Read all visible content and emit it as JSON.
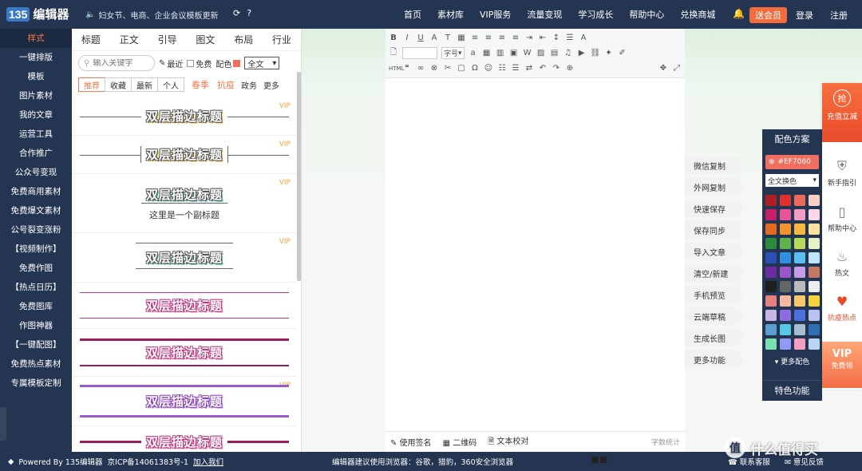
{
  "brand": {
    "mark": "135",
    "name": "编辑器"
  },
  "notice": "妇女节、电商、企业会议模板更新",
  "topnav": [
    "首页",
    "素材库",
    "VIP服务",
    "流量变现",
    "学习成长",
    "帮助中心",
    "兑换商城"
  ],
  "header": {
    "vip": "送会员",
    "login": "登录",
    "register": "注册"
  },
  "leftnav": [
    "样式",
    "一键排版",
    "模板",
    "图片素材",
    "我的文章",
    "运营工具",
    "合作推广",
    "公众号变现",
    "免费商用素材",
    "免费爆文素材",
    "公号裂变涨粉",
    "【视频制作】",
    "免费作图",
    "【热点日历】",
    "免费图库",
    "作图神器",
    "【一键配图】",
    "免费热点素材",
    "专属模板定制"
  ],
  "categories": [
    "标题",
    "正文",
    "引导",
    "图文",
    "布局",
    "行业"
  ],
  "search": {
    "placeholder": "输入关键字",
    "recent": "最近",
    "free": "免费",
    "color_label": "配色",
    "scope": "全文"
  },
  "filters": {
    "tabs": [
      "推荐",
      "收藏",
      "最新",
      "个人"
    ],
    "tags": [
      "春季",
      "抗疫"
    ],
    "more": [
      "政务",
      "更多"
    ]
  },
  "templates": {
    "title": "双层描边标题",
    "subtitle": "这里是一个副标题",
    "vip": "VIP"
  },
  "toolbar": {
    "size": "字号"
  },
  "editor_footer": [
    "使用签名",
    "二维码",
    "文本校对"
  ],
  "word_count": "字数统计",
  "actions": [
    "微信复制",
    "外网复制",
    "快速保存",
    "保存同步",
    "导入文章",
    "清空/新建",
    "手机预览",
    "云端草稿",
    "生成长图",
    "更多功能"
  ],
  "color_panel": {
    "title": "配色方案",
    "current": "#EF7060",
    "scope": "全文换色",
    "more": "更多配色",
    "feature": "特色功能"
  },
  "colors": {
    "accent": "#EF7060",
    "nav": "#243552",
    "orange": "#f37b4d"
  },
  "palette": [
    "#b01e22",
    "#e0312c",
    "#ec6a58",
    "#f8d0c8",
    "#c7206b",
    "#e8559a",
    "#f39cc6",
    "#fbd5e8",
    "#e56a1e",
    "#f5922b",
    "#f8b840",
    "#fbe39e",
    "#2d8a3a",
    "#5db44e",
    "#b6d95c",
    "#e8f2c6",
    "#2b4fb2",
    "#2f8fe0",
    "#5bbdf1",
    "#bfe5fb",
    "#6a2ca0",
    "#9a56c8",
    "#c79be6",
    "#c27a62",
    "#1f1f1f",
    "#666666",
    "#bbbbbb",
    "#eeeeee",
    "#e88080",
    "#f5b8a0",
    "#f7c86a",
    "#f3d23c",
    "#c7b7e6",
    "#8c6adf",
    "#4c6fe0",
    "#b8c4ef",
    "#5d9ed0",
    "#56c8e6",
    "#a9bccf",
    "#2f6fb5",
    "#7ae0b0",
    "#8f9af5",
    "#f49fbf",
    "#b9d5f5"
  ],
  "right_side": {
    "promo_icon": "抢",
    "promo": "充值立减",
    "items": [
      "新手指引",
      "帮助中心",
      "热文",
      "抗疫热点"
    ],
    "vip": "VIP",
    "vip_sub": "免费领"
  },
  "footer": {
    "powered": "Powered By 135编辑器",
    "icp": "京ICP备14061383号-1",
    "join": "加入我们",
    "browser": "编辑器建议使用浏览器：谷歌，猎豹，360安全浏览器",
    "service": "联系客服",
    "feedback": "意见反馈"
  },
  "watermark": "什么值得买"
}
